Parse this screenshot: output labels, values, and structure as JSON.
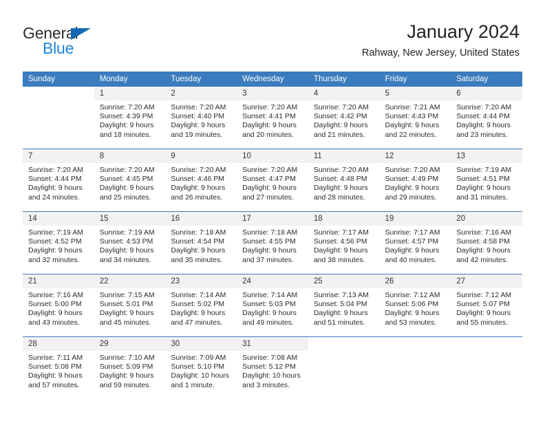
{
  "brand": {
    "line1": "General",
    "line2": "Blue",
    "triangle_color": "#1268b3",
    "line2_color": "#1f84d6"
  },
  "header": {
    "title": "January 2024",
    "location": "Rahway, New Jersey, United States"
  },
  "theme": {
    "header_bg": "#3a7cbe",
    "daynum_bg": "#f2f2f2",
    "row_border": "#3a7cbe"
  },
  "weekdays": [
    "Sunday",
    "Monday",
    "Tuesday",
    "Wednesday",
    "Thursday",
    "Friday",
    "Saturday"
  ],
  "weeks": [
    [
      {
        "day": "",
        "sunrise": "",
        "sunset": "",
        "daylight1": "",
        "daylight2": "",
        "blank": true
      },
      {
        "day": "1",
        "sunrise": "Sunrise: 7:20 AM",
        "sunset": "Sunset: 4:39 PM",
        "daylight1": "Daylight: 9 hours",
        "daylight2": "and 18 minutes."
      },
      {
        "day": "2",
        "sunrise": "Sunrise: 7:20 AM",
        "sunset": "Sunset: 4:40 PM",
        "daylight1": "Daylight: 9 hours",
        "daylight2": "and 19 minutes."
      },
      {
        "day": "3",
        "sunrise": "Sunrise: 7:20 AM",
        "sunset": "Sunset: 4:41 PM",
        "daylight1": "Daylight: 9 hours",
        "daylight2": "and 20 minutes."
      },
      {
        "day": "4",
        "sunrise": "Sunrise: 7:20 AM",
        "sunset": "Sunset: 4:42 PM",
        "daylight1": "Daylight: 9 hours",
        "daylight2": "and 21 minutes."
      },
      {
        "day": "5",
        "sunrise": "Sunrise: 7:21 AM",
        "sunset": "Sunset: 4:43 PM",
        "daylight1": "Daylight: 9 hours",
        "daylight2": "and 22 minutes."
      },
      {
        "day": "6",
        "sunrise": "Sunrise: 7:20 AM",
        "sunset": "Sunset: 4:44 PM",
        "daylight1": "Daylight: 9 hours",
        "daylight2": "and 23 minutes."
      }
    ],
    [
      {
        "day": "7",
        "sunrise": "Sunrise: 7:20 AM",
        "sunset": "Sunset: 4:44 PM",
        "daylight1": "Daylight: 9 hours",
        "daylight2": "and 24 minutes."
      },
      {
        "day": "8",
        "sunrise": "Sunrise: 7:20 AM",
        "sunset": "Sunset: 4:45 PM",
        "daylight1": "Daylight: 9 hours",
        "daylight2": "and 25 minutes."
      },
      {
        "day": "9",
        "sunrise": "Sunrise: 7:20 AM",
        "sunset": "Sunset: 4:46 PM",
        "daylight1": "Daylight: 9 hours",
        "daylight2": "and 26 minutes."
      },
      {
        "day": "10",
        "sunrise": "Sunrise: 7:20 AM",
        "sunset": "Sunset: 4:47 PM",
        "daylight1": "Daylight: 9 hours",
        "daylight2": "and 27 minutes."
      },
      {
        "day": "11",
        "sunrise": "Sunrise: 7:20 AM",
        "sunset": "Sunset: 4:48 PM",
        "daylight1": "Daylight: 9 hours",
        "daylight2": "and 28 minutes."
      },
      {
        "day": "12",
        "sunrise": "Sunrise: 7:20 AM",
        "sunset": "Sunset: 4:49 PM",
        "daylight1": "Daylight: 9 hours",
        "daylight2": "and 29 minutes."
      },
      {
        "day": "13",
        "sunrise": "Sunrise: 7:19 AM",
        "sunset": "Sunset: 4:51 PM",
        "daylight1": "Daylight: 9 hours",
        "daylight2": "and 31 minutes."
      }
    ],
    [
      {
        "day": "14",
        "sunrise": "Sunrise: 7:19 AM",
        "sunset": "Sunset: 4:52 PM",
        "daylight1": "Daylight: 9 hours",
        "daylight2": "and 32 minutes."
      },
      {
        "day": "15",
        "sunrise": "Sunrise: 7:19 AM",
        "sunset": "Sunset: 4:53 PM",
        "daylight1": "Daylight: 9 hours",
        "daylight2": "and 34 minutes."
      },
      {
        "day": "16",
        "sunrise": "Sunrise: 7:18 AM",
        "sunset": "Sunset: 4:54 PM",
        "daylight1": "Daylight: 9 hours",
        "daylight2": "and 35 minutes."
      },
      {
        "day": "17",
        "sunrise": "Sunrise: 7:18 AM",
        "sunset": "Sunset: 4:55 PM",
        "daylight1": "Daylight: 9 hours",
        "daylight2": "and 37 minutes."
      },
      {
        "day": "18",
        "sunrise": "Sunrise: 7:17 AM",
        "sunset": "Sunset: 4:56 PM",
        "daylight1": "Daylight: 9 hours",
        "daylight2": "and 38 minutes."
      },
      {
        "day": "19",
        "sunrise": "Sunrise: 7:17 AM",
        "sunset": "Sunset: 4:57 PM",
        "daylight1": "Daylight: 9 hours",
        "daylight2": "and 40 minutes."
      },
      {
        "day": "20",
        "sunrise": "Sunrise: 7:16 AM",
        "sunset": "Sunset: 4:58 PM",
        "daylight1": "Daylight: 9 hours",
        "daylight2": "and 42 minutes."
      }
    ],
    [
      {
        "day": "21",
        "sunrise": "Sunrise: 7:16 AM",
        "sunset": "Sunset: 5:00 PM",
        "daylight1": "Daylight: 9 hours",
        "daylight2": "and 43 minutes."
      },
      {
        "day": "22",
        "sunrise": "Sunrise: 7:15 AM",
        "sunset": "Sunset: 5:01 PM",
        "daylight1": "Daylight: 9 hours",
        "daylight2": "and 45 minutes."
      },
      {
        "day": "23",
        "sunrise": "Sunrise: 7:14 AM",
        "sunset": "Sunset: 5:02 PM",
        "daylight1": "Daylight: 9 hours",
        "daylight2": "and 47 minutes."
      },
      {
        "day": "24",
        "sunrise": "Sunrise: 7:14 AM",
        "sunset": "Sunset: 5:03 PM",
        "daylight1": "Daylight: 9 hours",
        "daylight2": "and 49 minutes."
      },
      {
        "day": "25",
        "sunrise": "Sunrise: 7:13 AM",
        "sunset": "Sunset: 5:04 PM",
        "daylight1": "Daylight: 9 hours",
        "daylight2": "and 51 minutes."
      },
      {
        "day": "26",
        "sunrise": "Sunrise: 7:12 AM",
        "sunset": "Sunset: 5:06 PM",
        "daylight1": "Daylight: 9 hours",
        "daylight2": "and 53 minutes."
      },
      {
        "day": "27",
        "sunrise": "Sunrise: 7:12 AM",
        "sunset": "Sunset: 5:07 PM",
        "daylight1": "Daylight: 9 hours",
        "daylight2": "and 55 minutes."
      }
    ],
    [
      {
        "day": "28",
        "sunrise": "Sunrise: 7:11 AM",
        "sunset": "Sunset: 5:08 PM",
        "daylight1": "Daylight: 9 hours",
        "daylight2": "and 57 minutes."
      },
      {
        "day": "29",
        "sunrise": "Sunrise: 7:10 AM",
        "sunset": "Sunset: 5:09 PM",
        "daylight1": "Daylight: 9 hours",
        "daylight2": "and 59 minutes."
      },
      {
        "day": "30",
        "sunrise": "Sunrise: 7:09 AM",
        "sunset": "Sunset: 5:10 PM",
        "daylight1": "Daylight: 10 hours",
        "daylight2": "and 1 minute."
      },
      {
        "day": "31",
        "sunrise": "Sunrise: 7:08 AM",
        "sunset": "Sunset: 5:12 PM",
        "daylight1": "Daylight: 10 hours",
        "daylight2": "and 3 minutes."
      },
      {
        "day": "",
        "sunrise": "",
        "sunset": "",
        "daylight1": "",
        "daylight2": "",
        "blank": true
      },
      {
        "day": "",
        "sunrise": "",
        "sunset": "",
        "daylight1": "",
        "daylight2": "",
        "blank": true
      },
      {
        "day": "",
        "sunrise": "",
        "sunset": "",
        "daylight1": "",
        "daylight2": "",
        "blank": true
      }
    ]
  ]
}
